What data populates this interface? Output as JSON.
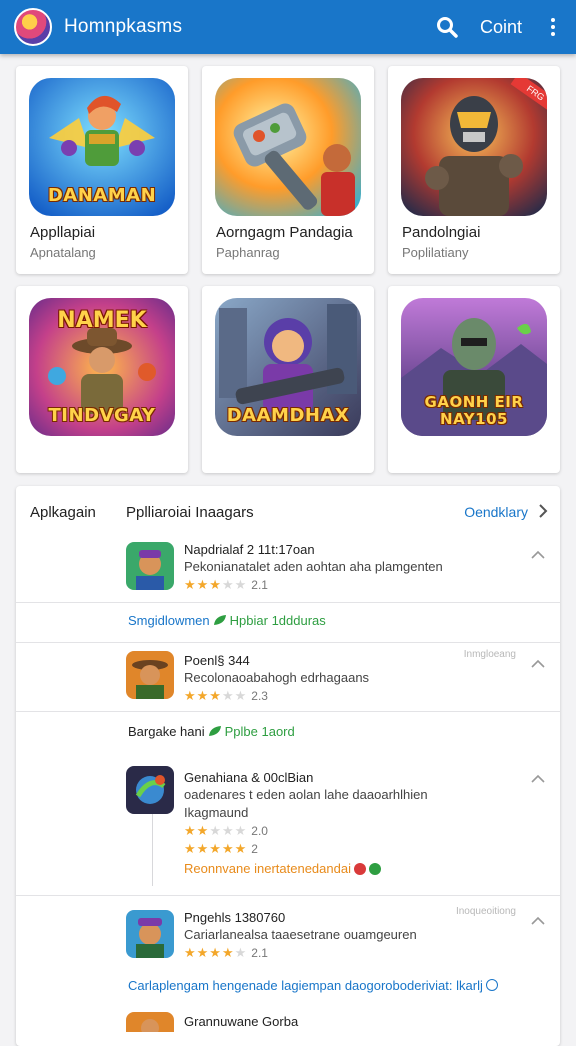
{
  "header": {
    "title": "Homnpkasms",
    "count_label": "Coint",
    "colors": {
      "bar": "#1976c9",
      "text": "#ffffff"
    }
  },
  "cards": [
    {
      "title": "Appllapiai",
      "subtitle": "Apnatalang",
      "art_text": "DANAMAN",
      "icon": "hero-fantasy-art"
    },
    {
      "title": "Aorngagm Pandagia",
      "subtitle": "Paphanrag",
      "art_text": "",
      "icon": "robot-hammer-art"
    },
    {
      "title": "Pandolngiai",
      "subtitle": "Poplilatiany",
      "art_text": "",
      "icon": "cyborg-soldier-art",
      "badge": "FRG"
    },
    {
      "title": "",
      "subtitle": "",
      "art_text": "TINDVGAY",
      "art_text_top": "NAMEK",
      "icon": "adventurer-art"
    },
    {
      "title": "",
      "subtitle": "",
      "art_text": "DAAMDHAX",
      "icon": "gunner-girl-art"
    },
    {
      "title": "",
      "subtitle": "",
      "art_text": "GAONH EIR NAY105",
      "icon": "orc-warrior-art"
    }
  ],
  "panel": {
    "label": "Aplkagain",
    "title": "Pplliaroiai Inaagars",
    "link": "Oendklary",
    "entries": [
      {
        "name": "Napdrialaf 2 11t:17oan",
        "desc": "Pekonianatalet aden aohtan aha plamgenten",
        "rating": "2.1",
        "stars": 3,
        "icon": "app-icon-1"
      },
      {
        "name": "Poenl§ 344",
        "desc": "Recolonaoabahogh edrhagaans",
        "rating": "2.3",
        "stars": 3,
        "icon": "app-icon-2",
        "faint": "Inmgloeang"
      },
      {
        "name": "Genahiana & 00clBian",
        "desc": "oadenares t eden aolan lahe daaoarhlhien",
        "desc2": "Ikagmaund",
        "rating": "2.0",
        "stars": 3,
        "rating2": "2",
        "stars2": 5,
        "orange": "Reonnvane inertatenedandai",
        "icon": "app-icon-3"
      },
      {
        "name": "Pngehls 1380760",
        "desc": "Cariarlanealsa taaesetrane ouamgeuren",
        "rating": "2.1",
        "stars": 4,
        "icon": "app-icon-4",
        "faint": "Inoqueoitiong"
      }
    ],
    "tags": [
      {
        "blue": "Smgidlowmen",
        "green": "Hpbiar 1ddduras"
      },
      {
        "dark": "Bargake hani",
        "green": "Pplbe 1aord"
      }
    ],
    "footer": "Carlaplengam hengenade lagiempan daogoroboderiviat: lkarlj",
    "peek": "Grannuwane Gorba"
  }
}
